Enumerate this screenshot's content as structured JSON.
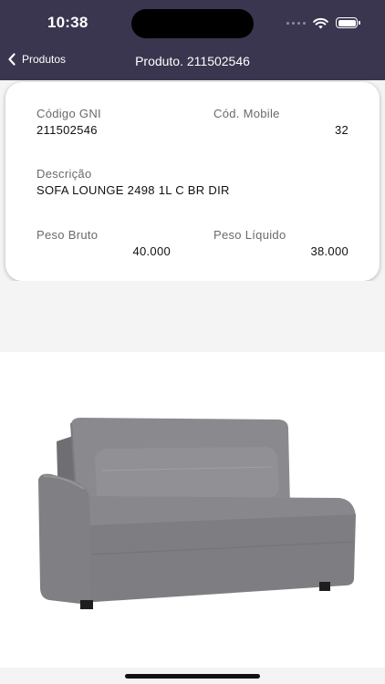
{
  "status_bar": {
    "time": "10:38"
  },
  "nav": {
    "back_label": "Produtos",
    "title": "Produto. 211502546"
  },
  "details": {
    "codigo_gni_label": "Código  GNI",
    "codigo_gni_value": "211502546",
    "cod_mobile_label": "Cód. Mobile",
    "cod_mobile_value": "32",
    "descricao_label": "Descrição",
    "descricao_value": "SOFA LOUNGE 2498 1L C BR DIR",
    "peso_bruto_label": "Peso Bruto",
    "peso_bruto_value": "40.000",
    "peso_liquido_label": "Peso Líquido",
    "peso_liquido_value": "38.000"
  },
  "colors": {
    "nav_bg": "#3a3650",
    "card_bg": "#ffffff",
    "page_bg": "#f4f4f4"
  },
  "icons": [
    "chevron-left-icon",
    "wifi-icon",
    "battery-icon",
    "cellular-dots-icon"
  ]
}
